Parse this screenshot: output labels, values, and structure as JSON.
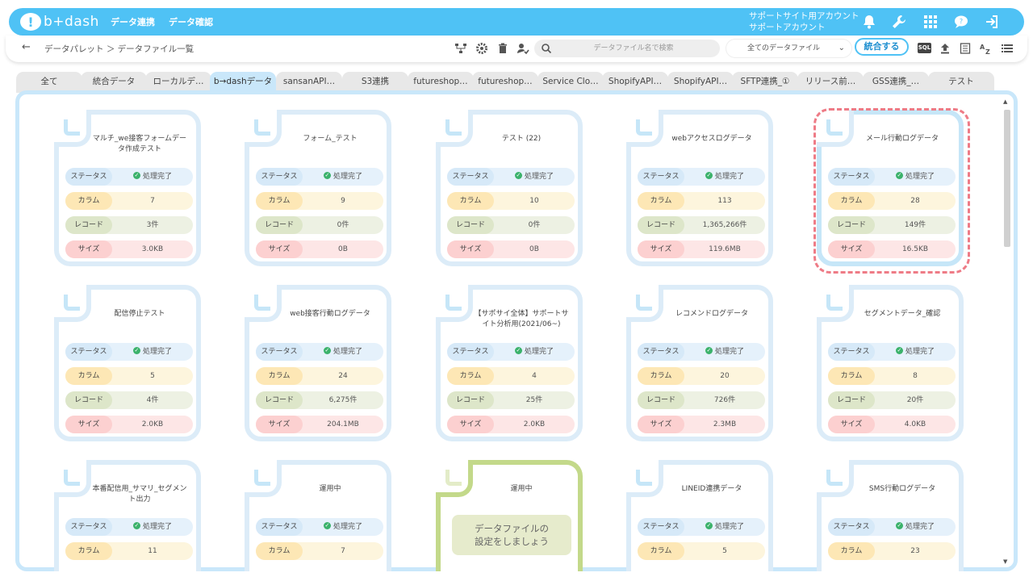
{
  "header": {
    "logo_text": "b+dash",
    "nav": [
      "データ連携",
      "データ確認"
    ],
    "account_line1": "サポートサイト用アカウント",
    "account_line2": "サポートアカウント"
  },
  "subheader": {
    "back_glyph": "←",
    "breadcrumb": "データパレット ＞ データファイル一覧",
    "search_placeholder": "データファイル名で検索",
    "filter_value": "全てのデータファイル",
    "merge_label": "統合する",
    "sql_label": "SQL"
  },
  "tabs": [
    "全て",
    "統合データ",
    "ローカルデ…",
    "b→dashデータ",
    "sansanAPI…",
    "S3連携",
    "futureshop…",
    "futureshop…",
    "Service Clo…",
    "ShopifyAPI…",
    "ShopifyAPI…",
    "SFTP連携_①",
    "リリース前…",
    "GSS連携_…",
    "テスト"
  ],
  "active_tab": 3,
  "row_labels": {
    "status": "ステータス",
    "columns": "カラム",
    "records": "レコード",
    "size": "サイズ"
  },
  "cards": [
    {
      "title": "マルチ_we接客フォームデータ作成テスト",
      "status": "処理完了",
      "columns": "7",
      "records": "3件",
      "size": "3.0KB"
    },
    {
      "title": "フォーム_テスト",
      "status": "処理完了",
      "columns": "9",
      "records": "0件",
      "size": "0B"
    },
    {
      "title": "テスト (22)",
      "status": "処理完了",
      "columns": "10",
      "records": "0件",
      "size": "0B"
    },
    {
      "title": "webアクセスログデータ",
      "status": "処理完了",
      "columns": "113",
      "records": "1,365,266件",
      "size": "119.6MB"
    },
    {
      "title": "メール行動ログデータ",
      "status": "処理完了",
      "columns": "28",
      "records": "149件",
      "size": "16.5KB"
    },
    {
      "title": "配信停止テスト",
      "status": "処理完了",
      "columns": "5",
      "records": "4件",
      "size": "2.0KB"
    },
    {
      "title": "web接客行動ログデータ",
      "status": "処理完了",
      "columns": "24",
      "records": "6,275件",
      "size": "204.1MB"
    },
    {
      "title": "【サポサイ全体】サポートサイト分析用(2021/06~)",
      "status": "処理完了",
      "columns": "4",
      "records": "25件",
      "size": "2.0KB"
    },
    {
      "title": "レコメンドログデータ",
      "status": "処理完了",
      "columns": "20",
      "records": "726件",
      "size": "2.3MB"
    },
    {
      "title": "セグメントデータ_確認",
      "status": "処理完了",
      "columns": "8",
      "records": "20件",
      "size": "4.0KB"
    },
    {
      "title": "本番配信用_サマリ_セグメント出力",
      "status": "処理完了",
      "columns": "11"
    },
    {
      "title": "運用中",
      "status": "処理完了",
      "columns": "7"
    },
    {
      "title": "運用中",
      "setup_line1": "データファイルの",
      "setup_line2": "設定をしましょう"
    },
    {
      "title": "LINEID連携データ",
      "status": "処理完了",
      "columns": "5"
    },
    {
      "title": "SMS行動ログデータ",
      "status": "処理完了",
      "columns": "23"
    }
  ],
  "colors": {
    "accent": "#4fc2f5",
    "status_ok": "#3bb26b",
    "highlight": "#ee7b86"
  }
}
